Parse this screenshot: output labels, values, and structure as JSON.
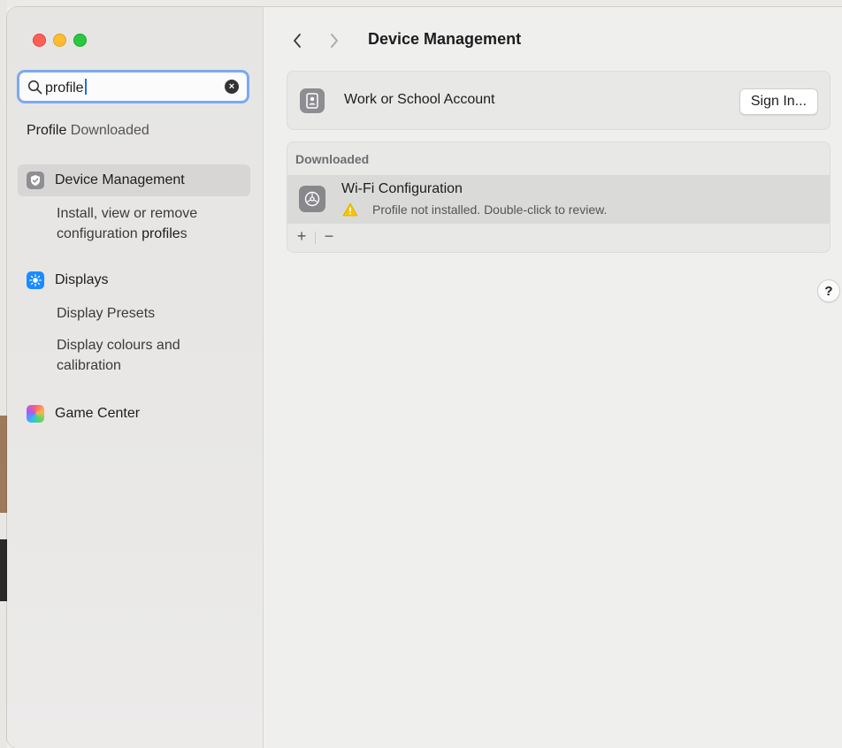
{
  "search": {
    "value": "profile",
    "clear_glyph": "×"
  },
  "suggestion": {
    "match": "Profile",
    "rest": " Downloaded"
  },
  "sidebar": {
    "items": [
      {
        "label": "Device Management",
        "icon": "device-management-icon",
        "selected": true
      },
      {
        "label": "Displays",
        "icon": "displays-icon"
      },
      {
        "label": "Game Center",
        "icon": "game-center-icon"
      }
    ],
    "device_sub": {
      "text": "Install, view or remove",
      "line2_pre": "configuration ",
      "line2_match": "profile",
      "line2_post": "s"
    },
    "display_sub1": "Display Presets",
    "display_sub2_l1": "Display colours and",
    "display_sub2_l2": "calibration"
  },
  "header": {
    "title": "Device Management"
  },
  "account": {
    "label": "Work or School Account",
    "button": "Sign In..."
  },
  "downloaded": {
    "header": "Downloaded",
    "row": {
      "name": "Wi-Fi Configuration",
      "status": "Profile not installed. Double-click to review."
    },
    "add_label": "+",
    "remove_label": "−"
  },
  "help_label": "?",
  "colors": {
    "accent": "#1f6fe5",
    "focus_ring": "#7aa9f0",
    "warning": "#f5c400"
  }
}
